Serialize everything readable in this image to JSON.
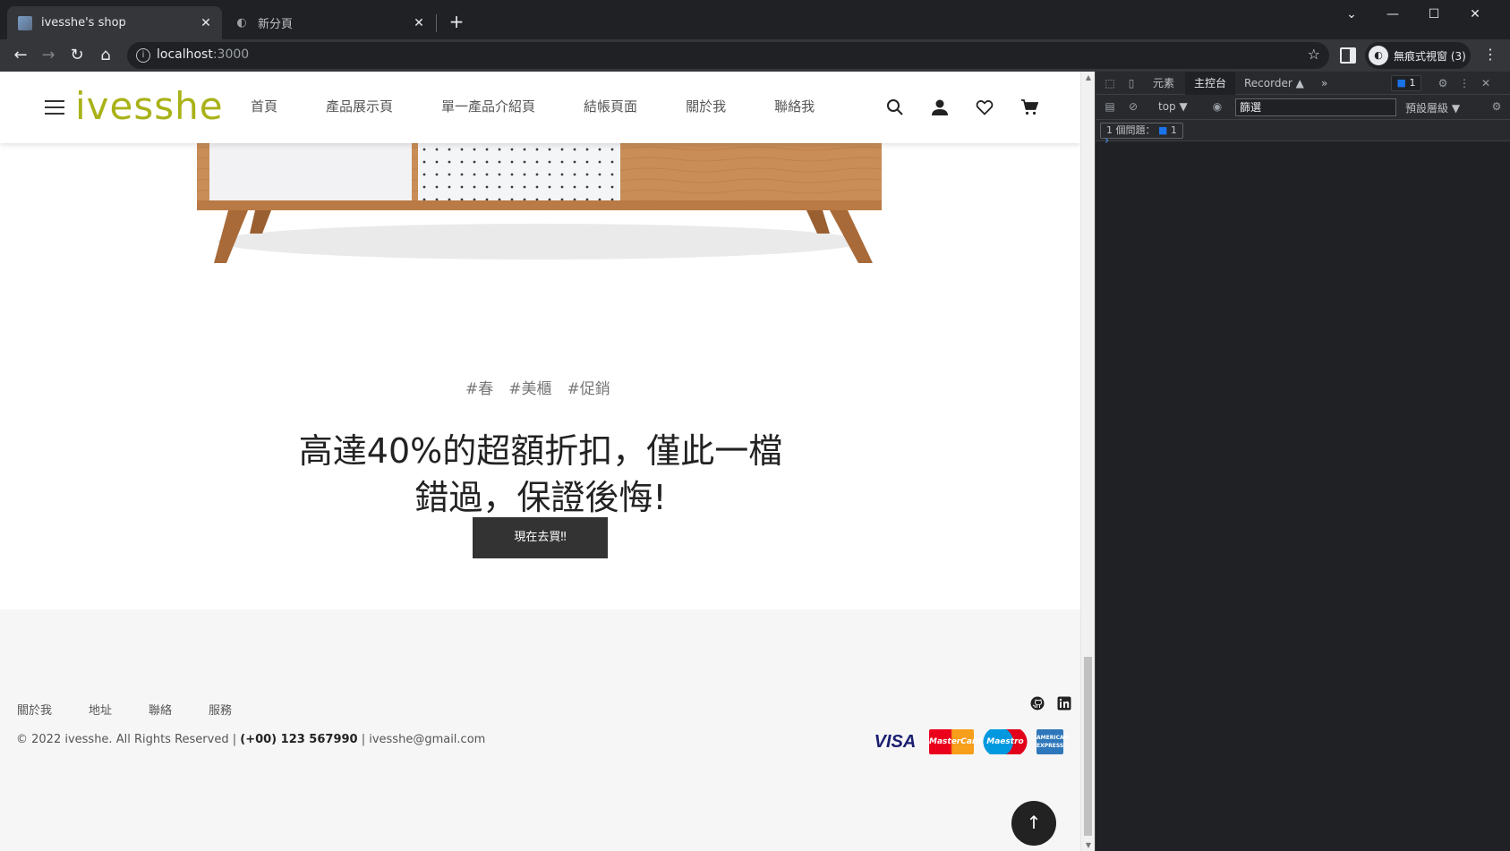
{
  "browser": {
    "tabs": [
      {
        "title": "ivesshe's shop",
        "close": "✕"
      },
      {
        "title": "新分頁",
        "close": "✕"
      }
    ],
    "new_tab": "+",
    "url_host": "localhost",
    "url_port": ":3000",
    "profile_label": "無痕式視窗 (3)"
  },
  "site": {
    "logo": "ivesshe",
    "nav": [
      "首頁",
      "產品展示頁",
      "單一產品介紹頁",
      "結帳頁面",
      "關於我",
      "聯絡我"
    ],
    "tags": [
      "#春",
      "#美櫃",
      "#促銷"
    ],
    "headline_line1": "高達40%的超額折扣，僅此一檔",
    "headline_line2": "錯過，保證後悔!",
    "cta": "現在去買‼",
    "footer_nav": [
      "關於我",
      "地址",
      "聯絡",
      "服務"
    ],
    "copyright_prefix": "© 2022 ivesshe. All Rights Reserved |",
    "phone": "(+00) 123 567990",
    "email_sep": "| ivesshe@gmail.com",
    "payments": {
      "visa": "VISA",
      "mastercard": "MasterCard",
      "maestro": "Maestro",
      "amex": "AMERICAN EXPRESS"
    },
    "to_top": "↑"
  },
  "devtools": {
    "tabs": [
      "元素",
      "主控台",
      "Recorder ▲",
      "»"
    ],
    "issue_badge": "1",
    "context": "top ▼",
    "filter_placeholder": "篩選",
    "level": "預設層級 ▼",
    "issues_label": "1 個問題：",
    "issues_count": "1",
    "prompt": "›"
  }
}
